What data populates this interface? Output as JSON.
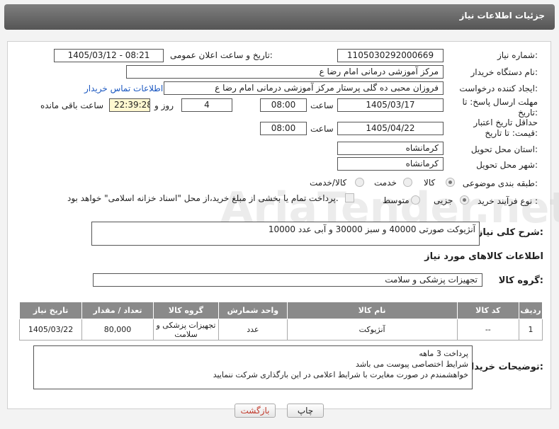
{
  "title": "جزئیات اطلاعات نیاز",
  "fields": {
    "need_number_label": "شماره نیاز:",
    "need_number": "1105030292000669",
    "announce_label": "تاریخ و ساعت اعلان عمومی:",
    "announce_value": "1405/03/12 - 08:21",
    "buyer_org_label": "نام دستگاه خریدار:",
    "buyer_org": "مرکز آموزشی  درمانی امام رضا  ع",
    "requester_label": "ایجاد کننده درخواست:",
    "requester": "فروزان محبی ده گلی پرستار مرکز آموزشی  درمانی امام رضا  ع",
    "contact_link": "اطلاعات تماس خریدار",
    "deadline_label": "مهلت ارسال پاسخ: تا تاریخ:",
    "deadline_date": "1405/03/17",
    "time_label": "ساعت",
    "deadline_time": "08:00",
    "days": "4",
    "days_label": "روز و",
    "remaining_time": "22:39:28",
    "remaining_label": "ساعت باقی مانده",
    "validity_label": "حداقل تاریخ اعتبار قیمت: تا تاریخ:",
    "validity_date": "1405/04/22",
    "validity_time": "08:00",
    "province_label": "استان محل تحویل:",
    "province": "کرمانشاه",
    "city_label": "شهر محل تحویل:",
    "city": "کرمانشاه",
    "category_label": "طبقه بندی موضوعی:",
    "category_options": [
      "کالا",
      "خدمت",
      "کالا/خدمت"
    ],
    "purchase_type_label": "نوع فرآیند خرید :",
    "purchase_options": [
      "جزیی",
      "متوسط"
    ],
    "payment_note": "پرداخت تمام یا بخشی از مبلغ خرید،از محل \"اسناد خزانه اسلامی\" خواهد بود.",
    "summary_label": "شرح کلی نیاز:",
    "summary": "آنژیوکت   صورتی    40000  و سبز   30000  و آبی   عدد 10000",
    "goods_info_label": "اطلاعات کالاهای مورد نیاز",
    "goods_group_label": "گروه کالا:",
    "goods_group": "تجهیزات پزشکی و سلامت",
    "buyer_notes_label": "توضیحات خریدار:",
    "buyer_notes": [
      "پرداخت 3 ماهه",
      "شرایط اختصاصی پیوست می باشد",
      "خواهشمندم  در صورت مغایرت با شرایط اعلامی در این بارگذاری شرکت ننمایید"
    ]
  },
  "table": {
    "headers": [
      "ردیف",
      "کد کالا",
      "نام کالا",
      "واحد شمارش",
      "گروه کالا",
      "تعداد / مقدار",
      "تاریخ نیاز"
    ],
    "rows": [
      [
        "1",
        "--",
        "آنژیوکت",
        "عدد",
        "تجهیزات پزشکی و سلامت",
        "80,000",
        "1405/03/22"
      ]
    ]
  },
  "buttons": {
    "print": "چاپ",
    "back": "بازگشت"
  },
  "watermark": "AriaTender.net"
}
